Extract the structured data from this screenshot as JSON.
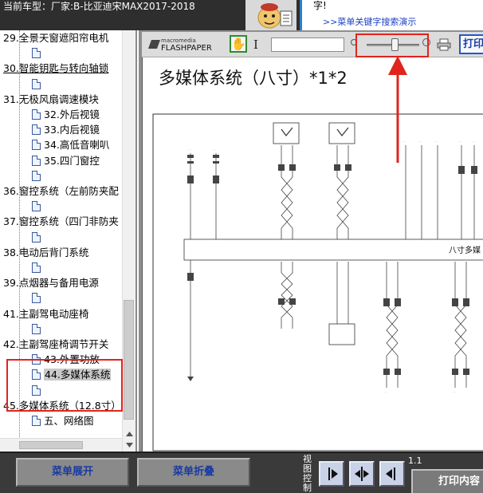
{
  "titlebar": {
    "car_label": "当前车型：厂家:B-比亚迪宋MAX2017-2018"
  },
  "tip": {
    "top_text": "字!",
    "link_text": ">>菜单关键字搜索演示"
  },
  "tree": {
    "items": [
      {
        "label": "29.全景天窗遮阳帘电机",
        "level": 0
      },
      {
        "label": "",
        "level": 1
      },
      {
        "label": "30.智能钥匙与转向轴锁",
        "level": 0,
        "underline": true
      },
      {
        "label": "",
        "level": 1
      },
      {
        "label": "31.无极风扇调速模块",
        "level": 0
      },
      {
        "label": "32.外后视镜",
        "level": 1
      },
      {
        "label": "33.内后视镜",
        "level": 1
      },
      {
        "label": "34.高低音喇叭",
        "level": 1
      },
      {
        "label": "35.四门窗控",
        "level": 1
      },
      {
        "label": "",
        "level": 1
      },
      {
        "label": "36.窗控系统（左前防夹配",
        "level": 0
      },
      {
        "label": "",
        "level": 1
      },
      {
        "label": "37.窗控系统（四门非防夹",
        "level": 0
      },
      {
        "label": "",
        "level": 1
      },
      {
        "label": "38.电动后背门系统",
        "level": 0
      },
      {
        "label": "",
        "level": 1
      },
      {
        "label": "39.点烟器与备用电源",
        "level": 0
      },
      {
        "label": "",
        "level": 1
      },
      {
        "label": "41.主副驾电动座椅",
        "level": 0
      },
      {
        "label": "",
        "level": 1
      },
      {
        "label": "42.主副驾座椅调节开关",
        "level": 0
      },
      {
        "label": "43.外置功放",
        "level": 1
      },
      {
        "label": "44.多媒体系统",
        "level": 1,
        "selected": true
      },
      {
        "label": "",
        "level": 1
      },
      {
        "label": "45.多媒体系统（12.8寸）",
        "level": 0
      },
      {
        "label": "五、网络图",
        "level": 1
      }
    ]
  },
  "viewer": {
    "logo_line1": "macromedia",
    "logo_line2": "FLASHPAPER",
    "text_tool": "I",
    "print_label": "打印",
    "zoom_level": 0.55,
    "doc_title": "多媒体系统（八寸）*1*2",
    "schematic_label": "八寸多媒"
  },
  "bottom": {
    "expand_label": "菜单展开",
    "collapse_label": "菜单折叠",
    "view_ctrl_label": "视图控制",
    "page_indicator": "1.1",
    "print_content_label": "打印内容"
  },
  "colors": {
    "annotation_red": "#e0241d",
    "link_blue": "#1a3fc8",
    "toolbar_bg": "#dcdcdc",
    "bottom_bg": "#3a3a3a"
  }
}
